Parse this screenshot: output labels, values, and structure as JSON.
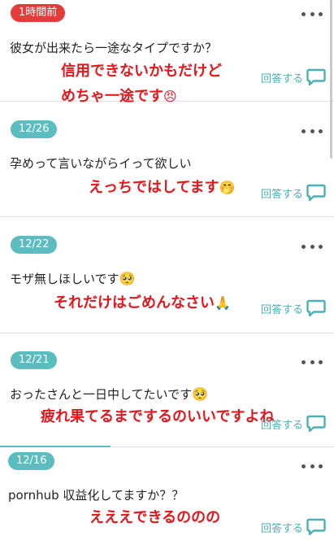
{
  "posts": [
    {
      "badge": "1時間前",
      "badge_color": "red",
      "question": "彼女が出来たら一途なタイプですか？",
      "reply_lines": [
        "信用できないかもだけど",
        "めちゃ一途です"
      ],
      "reply_emoji": "😠",
      "answer_label": "回答する"
    },
    {
      "badge": "12/26",
      "badge_color": "teal",
      "question": "孕めって言いながらイって欲しい",
      "reply_lines": [
        "えっちではしてます"
      ],
      "reply_emoji": "🤭",
      "answer_label": "回答する"
    },
    {
      "badge": "12/22",
      "badge_color": "teal",
      "question": "モザ無しほしいです",
      "question_emoji": "🥺",
      "reply_lines": [
        "それだけはごめんなさい"
      ],
      "reply_emoji": "🙏",
      "answer_label": "回答する"
    },
    {
      "badge": "12/21",
      "badge_color": "teal",
      "question": "おったさんと一日中してたいです",
      "question_emoji": "🥺",
      "reply_lines": [
        "疲れ果てるまでするのいいですよね"
      ],
      "reply_emoji": "",
      "answer_label": "回答する"
    },
    {
      "badge": "12/16",
      "badge_color": "teal",
      "question": "pornhub 収益化してますか？？",
      "reply_lines": [
        "えええできるののの"
      ],
      "reply_emoji": "",
      "answer_label": "回答する"
    }
  ],
  "icons": {
    "more": "more-horizontal-icon",
    "answer": "speech-bubble-icon"
  },
  "colors": {
    "red_badge": "#e63b3b",
    "teal_badge": "#5bbdc0",
    "reply_text": "#e8151b",
    "answer_text": "#4ab0b4"
  }
}
